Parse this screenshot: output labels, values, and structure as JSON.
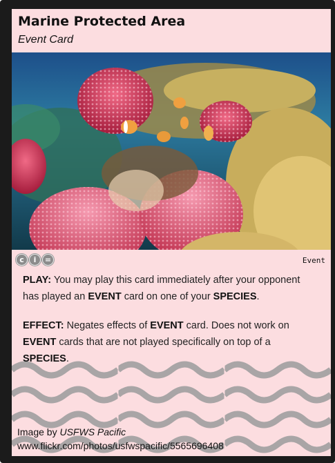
{
  "card": {
    "title": "Marine Protected Area",
    "subtitle": "Event Card",
    "type_label": "Event",
    "license_icons": [
      "cc-icon",
      "by-icon",
      "nd-icon"
    ],
    "play": {
      "label": "PLAY:",
      "text_1": " You may play this card immediately after your opponent has played an ",
      "keyword_1": "EVENT",
      "text_2": " card on one of your ",
      "keyword_2": "SPECIES",
      "text_3": "."
    },
    "effect": {
      "label": "EFFECT:",
      "text_1": " Negates effects of ",
      "keyword_1": "EVENT",
      "text_2": " card. Does not work on ",
      "keyword_2": "EVENT",
      "text_3": " cards that are not played specifically on top of a ",
      "keyword_3": "SPECIES",
      "text_4": "."
    },
    "credit": {
      "prefix": "Image by ",
      "author": "USFWS Pacific",
      "url": "www.flickr.com/photos/usfwspacific/5565696408"
    }
  },
  "colors": {
    "card_border": "#1b1b1b",
    "card_background": "#fcdde0",
    "wave_pattern": "#a9a5a6"
  }
}
